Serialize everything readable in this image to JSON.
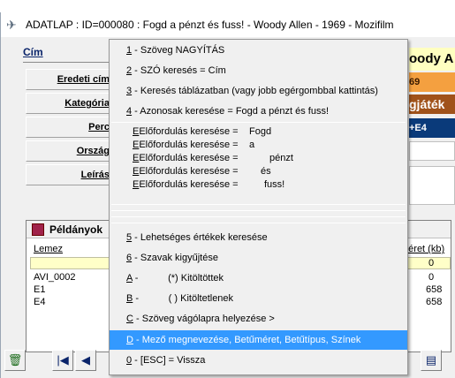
{
  "window": {
    "title": "ADATLAP : ID=000080 : Fogd a pénzt és fuss! - Woody Allen - 1969 - Mozifilm"
  },
  "form": {
    "cim_label": "Cím",
    "fields": [
      {
        "label": "Eredeti cím"
      },
      {
        "label": "Kategória"
      },
      {
        "label": "Perc"
      },
      {
        "label": "Ország"
      },
      {
        "label": "Leírás"
      }
    ],
    "values": {
      "title_partial": "oody A",
      "year": "69",
      "category_partial": "gjáték",
      "duration_partial": "+E4"
    },
    "colors": {
      "title_bg": "#ffffc0",
      "year_bg": "#f4a040",
      "category_bg": "#a0521a",
      "duration_bg": "#0a3a7a"
    }
  },
  "copies": {
    "title": "Példányok",
    "col_lemez": "Lemez",
    "col_meret": "méret (kb)",
    "rows": [
      {
        "lemez": "",
        "meret": "0"
      },
      {
        "lemez": "AVI_0002",
        "meret": "0"
      },
      {
        "lemez": "E1",
        "meret": "658"
      },
      {
        "lemez": "E4",
        "meret": "658"
      }
    ]
  },
  "menu": {
    "items": [
      {
        "key": "1",
        "text": " - Szöveg NAGYÍTÁS"
      },
      {
        "key": "2",
        "text": " - SZÓ keresés = Cím"
      },
      {
        "key": "3",
        "text": " - Keresés táblázatban (vagy jobb egérgombbal kattintás)"
      },
      {
        "key": "4",
        "text": " -   Azonosak keresése = Fogd a pénzt és fuss!"
      }
    ],
    "occurrence_label": "Előfordulás keresése =",
    "occurrences": [
      "Fogd",
      "a",
      "pénzt",
      "és",
      "fuss!"
    ],
    "items2": [
      {
        "key": "5",
        "text": " - Lehetséges értékek keresése"
      },
      {
        "key": "6",
        "text": " -  Szavak kigyűjtése"
      },
      {
        "key": "A",
        "text": " -           (*) Kitöltöttek"
      },
      {
        "key": "B",
        "text": " -           ( ) Kitöltetlenek"
      },
      {
        "key": "C",
        "text": " - Szöveg vágólapra helyezése >"
      },
      {
        "key": "D",
        "text": " - Mező megnevezése, Betűméret, Betűtípus, Színek"
      },
      {
        "key": "0",
        "text": " - [ESC] = Vissza"
      }
    ],
    "highlight_color": "#3399ff"
  }
}
